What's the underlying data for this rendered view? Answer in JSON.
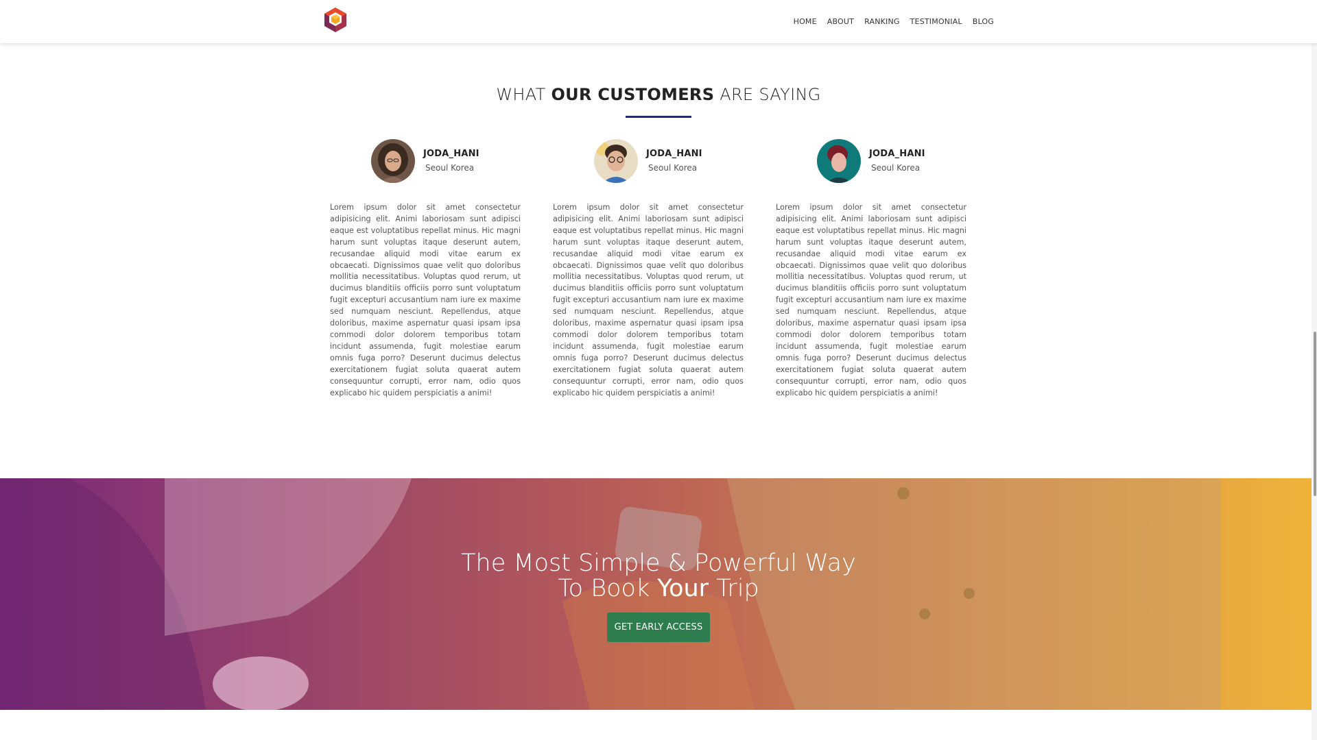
{
  "header": {
    "logo_icon": "hexagon-cube-logo",
    "nav": [
      "HOME",
      "ABOUT",
      "RANKING",
      "TESTIMONIAL",
      "BLOG"
    ]
  },
  "testimonials": {
    "title_pre": "WHAT ",
    "title_bold": "OUR CUSTOMERS",
    "title_post": " ARE SAYING",
    "accent_color": "#1b2a8a",
    "items": [
      {
        "name": "JODA_HANI",
        "location": "Seoul Korea",
        "text": "Lorem ipsum dolor sit amet consectetur adipisicing elit. Animi laboriosam sunt adipisci eaque est voluptatibus repellat minus. Hic magni harum sunt voluptas itaque deserunt autem, recusandae aliquid modi vitae earum ex obcaecati. Dignissimos quae velit quo doloribus mollitia necessitatibus. Voluptas quod rerum, ut ducimus blanditiis officiis porro sunt voluptatum fugit excepturi accusantium nam iure ex maxime sed numquam nesciunt. Repellendus, atque doloribus, maxime aspernatur quasi ipsam ipsa commodi dolor dolorem temporibus totam incidunt assumenda, fugit molestiae earum omnis fuga porro? Deserunt ducimus delectus exercitationem fugiat soluta quaerat autem consequuntur corrupti, error nam, odio quos explicabo hic quidem perspiciatis a animi!"
      },
      {
        "name": "JODA_HANI",
        "location": "Seoul Korea",
        "text": "Lorem ipsum dolor sit amet consectetur adipisicing elit. Animi laboriosam sunt adipisci eaque est voluptatibus repellat minus. Hic magni harum sunt voluptas itaque deserunt autem, recusandae aliquid modi vitae earum ex obcaecati. Dignissimos quae velit quo doloribus mollitia necessitatibus. Voluptas quod rerum, ut ducimus blanditiis officiis porro sunt voluptatum fugit excepturi accusantium nam iure ex maxime sed numquam nesciunt. Repellendus, atque doloribus, maxime aspernatur quasi ipsam ipsa commodi dolor dolorem temporibus totam incidunt assumenda, fugit molestiae earum omnis fuga porro? Deserunt ducimus delectus exercitationem fugiat soluta quaerat autem consequuntur corrupti, error nam, odio quos explicabo hic quidem perspiciatis a animi!"
      },
      {
        "name": "JODA_HANI",
        "location": "Seoul Korea",
        "text": "Lorem ipsum dolor sit amet consectetur adipisicing elit. Animi laboriosam sunt adipisci eaque est voluptatibus repellat minus. Hic magni harum sunt voluptas itaque deserunt autem, recusandae aliquid modi vitae earum ex obcaecati. Dignissimos quae velit quo doloribus mollitia necessitatibus. Voluptas quod rerum, ut ducimus blanditiis officiis porro sunt voluptatum fugit excepturi accusantium nam iure ex maxime sed numquam nesciunt. Repellendus, atque doloribus, maxime aspernatur quasi ipsam ipsa commodi dolor dolorem temporibus totam incidunt assumenda, fugit molestiae earum omnis fuga porro? Deserunt ducimus delectus exercitationem fugiat soluta quaerat autem consequuntur corrupti, error nam, odio quos explicabo hic quidem perspiciatis a animi!"
      }
    ]
  },
  "banner": {
    "line1": "The Most Simple & Powerful Way",
    "line2_pre": "To Book ",
    "line2_bold": "Your",
    "line2_post": " Trip",
    "cta_label": "GET EARLY ACCESS",
    "gradient_left": "#7b2a7a",
    "gradient_right": "#f0b43a",
    "cta_color": "#2e7d4f"
  }
}
